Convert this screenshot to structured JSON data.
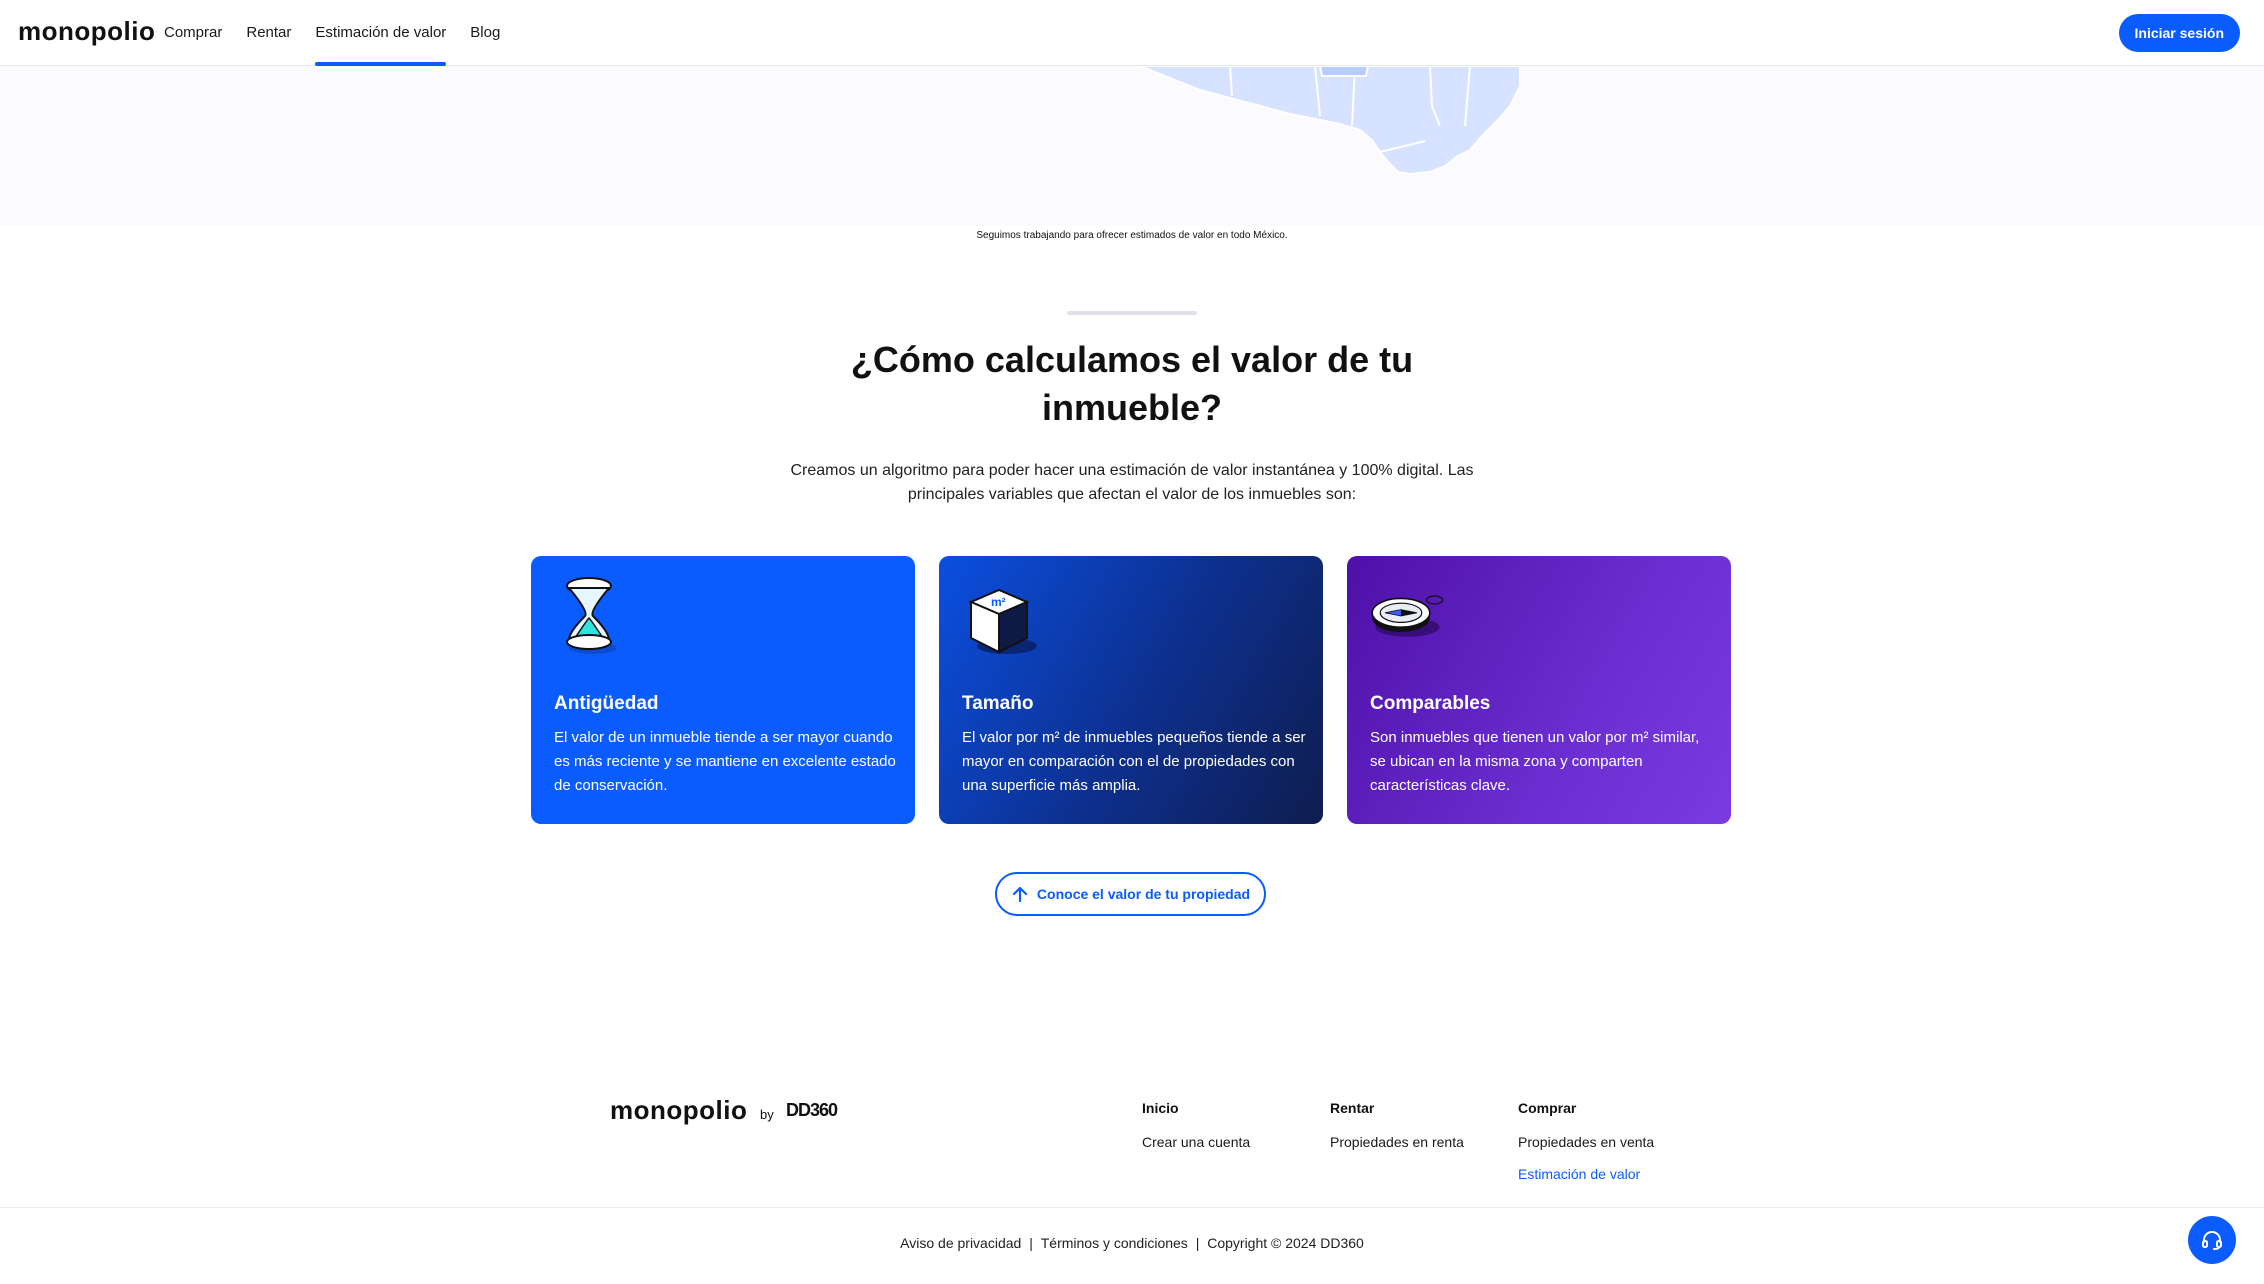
{
  "header": {
    "logo": "monopolio",
    "nav": [
      {
        "label": "Comprar"
      },
      {
        "label": "Rentar"
      },
      {
        "label": "Estimación de valor"
      },
      {
        "label": "Blog"
      }
    ],
    "login_label": "Iniciar sesión"
  },
  "map": {
    "note": "Seguimos trabajando para ofrecer estimados de valor en todo México."
  },
  "section": {
    "title": "¿Cómo calculamos el valor de tu inmueble?",
    "subtitle": "Creamos un algoritmo para poder hacer una estimación de valor instantánea y 100% digital. Las principales variables que afectan el valor de los inmuebles son:",
    "cards": [
      {
        "icon": "hourglass-icon",
        "title": "Antigüedad",
        "text": "El valor de un inmueble tiende a ser mayor cuando es más reciente y se mantiene en excelente estado de conservación."
      },
      {
        "icon": "cube-m2-icon",
        "title": "Tamaño",
        "text": "El valor por m² de inmuebles pequeños tiende a ser mayor en comparación con el de propiedades con una superficie más amplia."
      },
      {
        "icon": "compass-icon",
        "title": "Comparables",
        "text": "Son inmuebles que tienen un valor por m² similar, se ubican en la misma zona y comparten características clave."
      }
    ],
    "cta_label": "Conoce el valor de tu propiedad"
  },
  "footer": {
    "logo": "monopolio",
    "by": "by",
    "partner": "DD360",
    "columns": [
      {
        "heading": "Inicio",
        "links": [
          "Crear una cuenta"
        ]
      },
      {
        "heading": "Rentar",
        "links": [
          "Propiedades en renta"
        ]
      },
      {
        "heading": "Comprar",
        "links": [
          "Propiedades en venta",
          "Estimación de valor"
        ]
      }
    ],
    "legal": [
      "Aviso de privacidad",
      "Términos y condiciones",
      "Copyright © 2024 DD360"
    ],
    "separator": "|"
  },
  "colors": {
    "primary": "#0b5cff",
    "map_fill": "#d6e2ff",
    "card_purple": "#6a2ed0"
  }
}
